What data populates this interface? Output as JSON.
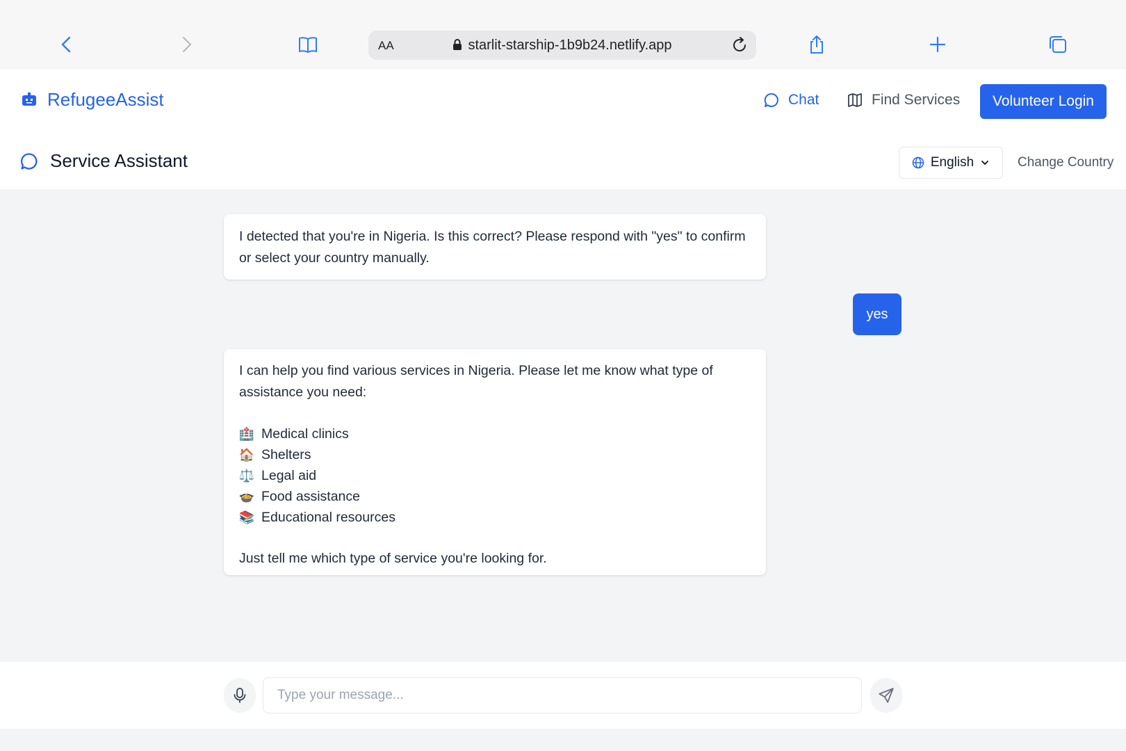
{
  "browser": {
    "text_size_label": "AA",
    "url": "starlit-starship-1b9b24.netlify.app"
  },
  "header": {
    "brand": "RefugeeAssist",
    "nav": {
      "chat": "Chat",
      "find_services": "Find Services"
    },
    "volunteer_login": "Volunteer Login"
  },
  "subheader": {
    "title": "Service Assistant",
    "language": "English",
    "change_country": "Change Country"
  },
  "colors": {
    "accent": "#2563eb",
    "chat_bg": "#f3f4f6"
  },
  "chat": {
    "messages": [
      {
        "role": "assistant",
        "text": "I detected that you're in Nigeria. Is this correct? Please respond with \"yes\" to confirm or select your country manually."
      },
      {
        "role": "user",
        "text": "yes"
      },
      {
        "role": "assistant",
        "intro": "I can help you find various services in Nigeria. Please let me know what type of assistance you need:",
        "services": [
          {
            "icon": "hospital-emoji",
            "emoji": "🏥",
            "label": "Medical clinics"
          },
          {
            "icon": "house-emoji",
            "emoji": "🏠",
            "label": "Shelters"
          },
          {
            "icon": "scales-emoji",
            "emoji": "⚖️",
            "label": "Legal aid"
          },
          {
            "icon": "bowl-emoji",
            "emoji": "🍲",
            "label": "Food assistance"
          },
          {
            "icon": "books-emoji",
            "emoji": "📚",
            "label": "Educational resources"
          }
        ],
        "outro": "Just tell me which type of service you're looking for."
      }
    ]
  },
  "input": {
    "placeholder": "Type your message...",
    "value": ""
  }
}
